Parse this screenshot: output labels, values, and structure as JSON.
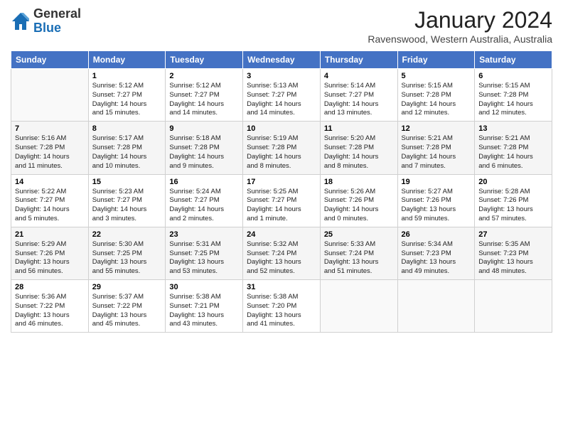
{
  "header": {
    "logo_line1": "General",
    "logo_line2": "Blue",
    "month_year": "January 2024",
    "location": "Ravenswood, Western Australia, Australia"
  },
  "days_of_week": [
    "Sunday",
    "Monday",
    "Tuesday",
    "Wednesday",
    "Thursday",
    "Friday",
    "Saturday"
  ],
  "weeks": [
    [
      {
        "date": "",
        "info": ""
      },
      {
        "date": "1",
        "info": "Sunrise: 5:12 AM\nSunset: 7:27 PM\nDaylight: 14 hours\nand 15 minutes."
      },
      {
        "date": "2",
        "info": "Sunrise: 5:12 AM\nSunset: 7:27 PM\nDaylight: 14 hours\nand 14 minutes."
      },
      {
        "date": "3",
        "info": "Sunrise: 5:13 AM\nSunset: 7:27 PM\nDaylight: 14 hours\nand 14 minutes."
      },
      {
        "date": "4",
        "info": "Sunrise: 5:14 AM\nSunset: 7:27 PM\nDaylight: 14 hours\nand 13 minutes."
      },
      {
        "date": "5",
        "info": "Sunrise: 5:15 AM\nSunset: 7:28 PM\nDaylight: 14 hours\nand 12 minutes."
      },
      {
        "date": "6",
        "info": "Sunrise: 5:15 AM\nSunset: 7:28 PM\nDaylight: 14 hours\nand 12 minutes."
      }
    ],
    [
      {
        "date": "7",
        "info": "Sunrise: 5:16 AM\nSunset: 7:28 PM\nDaylight: 14 hours\nand 11 minutes."
      },
      {
        "date": "8",
        "info": "Sunrise: 5:17 AM\nSunset: 7:28 PM\nDaylight: 14 hours\nand 10 minutes."
      },
      {
        "date": "9",
        "info": "Sunrise: 5:18 AM\nSunset: 7:28 PM\nDaylight: 14 hours\nand 9 minutes."
      },
      {
        "date": "10",
        "info": "Sunrise: 5:19 AM\nSunset: 7:28 PM\nDaylight: 14 hours\nand 8 minutes."
      },
      {
        "date": "11",
        "info": "Sunrise: 5:20 AM\nSunset: 7:28 PM\nDaylight: 14 hours\nand 8 minutes."
      },
      {
        "date": "12",
        "info": "Sunrise: 5:21 AM\nSunset: 7:28 PM\nDaylight: 14 hours\nand 7 minutes."
      },
      {
        "date": "13",
        "info": "Sunrise: 5:21 AM\nSunset: 7:28 PM\nDaylight: 14 hours\nand 6 minutes."
      }
    ],
    [
      {
        "date": "14",
        "info": "Sunrise: 5:22 AM\nSunset: 7:27 PM\nDaylight: 14 hours\nand 5 minutes."
      },
      {
        "date": "15",
        "info": "Sunrise: 5:23 AM\nSunset: 7:27 PM\nDaylight: 14 hours\nand 3 minutes."
      },
      {
        "date": "16",
        "info": "Sunrise: 5:24 AM\nSunset: 7:27 PM\nDaylight: 14 hours\nand 2 minutes."
      },
      {
        "date": "17",
        "info": "Sunrise: 5:25 AM\nSunset: 7:27 PM\nDaylight: 14 hours\nand 1 minute."
      },
      {
        "date": "18",
        "info": "Sunrise: 5:26 AM\nSunset: 7:26 PM\nDaylight: 14 hours\nand 0 minutes."
      },
      {
        "date": "19",
        "info": "Sunrise: 5:27 AM\nSunset: 7:26 PM\nDaylight: 13 hours\nand 59 minutes."
      },
      {
        "date": "20",
        "info": "Sunrise: 5:28 AM\nSunset: 7:26 PM\nDaylight: 13 hours\nand 57 minutes."
      }
    ],
    [
      {
        "date": "21",
        "info": "Sunrise: 5:29 AM\nSunset: 7:26 PM\nDaylight: 13 hours\nand 56 minutes."
      },
      {
        "date": "22",
        "info": "Sunrise: 5:30 AM\nSunset: 7:25 PM\nDaylight: 13 hours\nand 55 minutes."
      },
      {
        "date": "23",
        "info": "Sunrise: 5:31 AM\nSunset: 7:25 PM\nDaylight: 13 hours\nand 53 minutes."
      },
      {
        "date": "24",
        "info": "Sunrise: 5:32 AM\nSunset: 7:24 PM\nDaylight: 13 hours\nand 52 minutes."
      },
      {
        "date": "25",
        "info": "Sunrise: 5:33 AM\nSunset: 7:24 PM\nDaylight: 13 hours\nand 51 minutes."
      },
      {
        "date": "26",
        "info": "Sunrise: 5:34 AM\nSunset: 7:23 PM\nDaylight: 13 hours\nand 49 minutes."
      },
      {
        "date": "27",
        "info": "Sunrise: 5:35 AM\nSunset: 7:23 PM\nDaylight: 13 hours\nand 48 minutes."
      }
    ],
    [
      {
        "date": "28",
        "info": "Sunrise: 5:36 AM\nSunset: 7:22 PM\nDaylight: 13 hours\nand 46 minutes."
      },
      {
        "date": "29",
        "info": "Sunrise: 5:37 AM\nSunset: 7:22 PM\nDaylight: 13 hours\nand 45 minutes."
      },
      {
        "date": "30",
        "info": "Sunrise: 5:38 AM\nSunset: 7:21 PM\nDaylight: 13 hours\nand 43 minutes."
      },
      {
        "date": "31",
        "info": "Sunrise: 5:38 AM\nSunset: 7:20 PM\nDaylight: 13 hours\nand 41 minutes."
      },
      {
        "date": "",
        "info": ""
      },
      {
        "date": "",
        "info": ""
      },
      {
        "date": "",
        "info": ""
      }
    ]
  ]
}
